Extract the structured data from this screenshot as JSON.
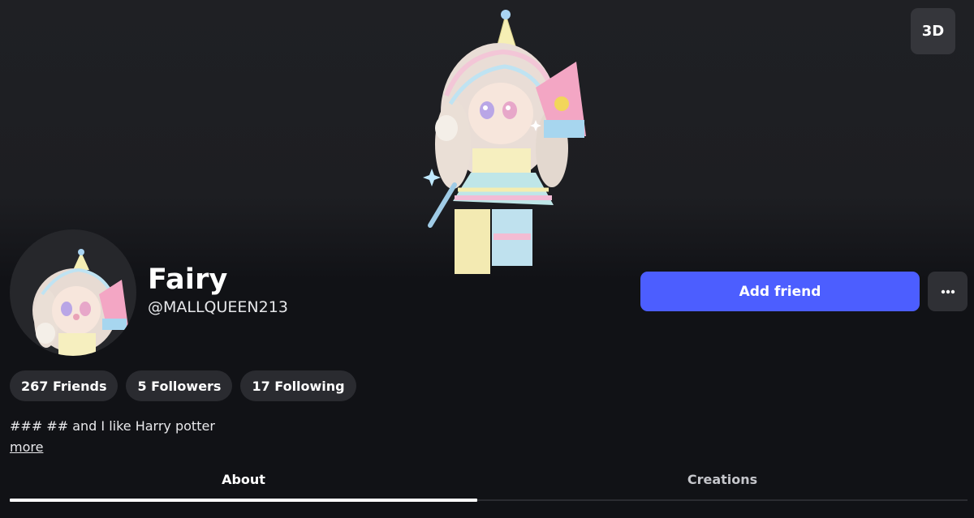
{
  "view_toggle": {
    "label": "3D"
  },
  "profile": {
    "display_name": "Fairy",
    "username": "@MALLQUEEN213"
  },
  "actions": {
    "add_friend_label": "Add friend",
    "more_icon": "ellipsis-icon"
  },
  "stats": [
    {
      "label": "267 Friends"
    },
    {
      "label": "5 Followers"
    },
    {
      "label": "17 Following"
    }
  ],
  "bio": {
    "text": "### ## and I like Harry potter",
    "more_label": "more"
  },
  "tabs": [
    {
      "label": "About",
      "active": true
    },
    {
      "label": "Creations",
      "active": false
    }
  ],
  "colors": {
    "background": "#111216",
    "accent": "#4c5eff",
    "pill": "#2a2b30"
  }
}
